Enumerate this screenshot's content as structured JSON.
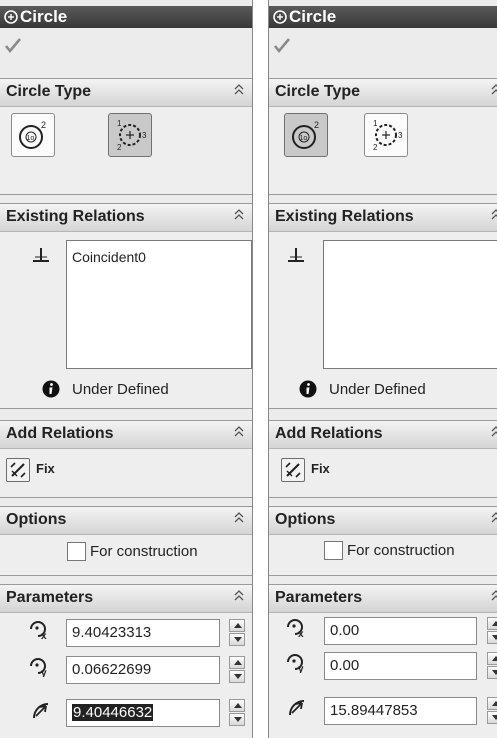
{
  "left": {
    "title": "Circle",
    "sections": {
      "circle_type": "Circle Type",
      "existing_relations": "Existing Relations",
      "add_relations": "Add Relations",
      "options": "Options",
      "parameters": "Parameters"
    },
    "relations": [
      "Coincident0"
    ],
    "status": "Under Defined",
    "fix_label": "Fix",
    "construction_label": "For construction",
    "params": {
      "x": "9.40423313",
      "y": "0.06622699",
      "radius": "9.40446632"
    },
    "active_type": "perimeter-circle"
  },
  "right": {
    "title": "Circle",
    "sections": {
      "circle_type": "Circle Type",
      "existing_relations": "Existing Relations",
      "add_relations": "Add Relations",
      "options": "Options",
      "parameters": "Parameters"
    },
    "relations": [],
    "status": "Under Defined",
    "fix_label": "Fix",
    "construction_label": "For construction",
    "params": {
      "x": "0.00",
      "y": "0.00",
      "radius": "15.89447853"
    },
    "active_type": "center-circle"
  },
  "icons": {
    "title": "circle-sketch-icon",
    "ok": "checkmark-icon",
    "collapse": "chevron-up-icon",
    "relation": "perpendicular-relation-icon",
    "info": "info-icon",
    "fix": "fix-relation-icon",
    "center_x": "center-x-icon",
    "center_y": "center-y-icon",
    "radius": "radius-icon"
  }
}
